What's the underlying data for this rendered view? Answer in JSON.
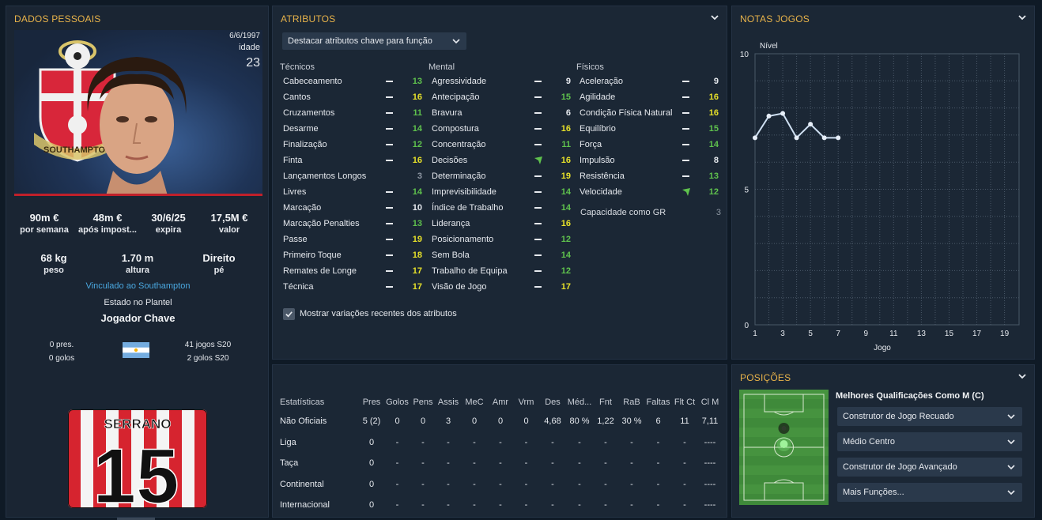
{
  "personal": {
    "title": "DADOS PESSOAIS",
    "dob": "6/6/1997",
    "age_label": "idade",
    "age": "23",
    "stats1": [
      {
        "value": "90m €",
        "label": "por semana"
      },
      {
        "value": "48m €",
        "label": "após impost..."
      },
      {
        "value": "30/6/25",
        "label": "expira"
      },
      {
        "value": "17,5M €",
        "label": "valor"
      }
    ],
    "stats2": [
      {
        "value": "68 kg",
        "label": "peso"
      },
      {
        "value": "1.70 m",
        "label": "altura"
      },
      {
        "value": "Direito",
        "label": "pé"
      }
    ],
    "contract_link": "Vinculado ao Southampton",
    "squad_label": "Estado no Plantel",
    "squad_value": "Jogador Chave",
    "intl_caps": "0 pres.",
    "intl_goals": "0 golos",
    "season_games": "41 jogos S20",
    "season_goals": "2 golos S20",
    "shirt_name": "SERRANO",
    "shirt_number": "15",
    "crest_text": "SOUTHAMPTON"
  },
  "attributes": {
    "title": "ATRIBUTOS",
    "highlight_dropdown": "Destacar atributos chave para função",
    "col_tecnicos": "Técnicos",
    "col_mental": "Mental",
    "col_fisicos": "Físicos",
    "tecnicos": [
      {
        "name": "Cabeceamento",
        "value": "13",
        "tier": "mid",
        "trend": "flat"
      },
      {
        "name": "Cantos",
        "value": "16",
        "tier": "high",
        "trend": "flat"
      },
      {
        "name": "Cruzamentos",
        "value": "11",
        "tier": "mid",
        "trend": "flat"
      },
      {
        "name": "Desarme",
        "value": "14",
        "tier": "mid",
        "trend": "flat"
      },
      {
        "name": "Finalização",
        "value": "12",
        "tier": "mid",
        "trend": "flat"
      },
      {
        "name": "Finta",
        "value": "16",
        "tier": "high",
        "trend": "flat"
      },
      {
        "name": "Lançamentos Longos",
        "value": "3",
        "tier": "low",
        "trend": "none"
      },
      {
        "name": "Livres",
        "value": "14",
        "tier": "mid",
        "trend": "flat"
      },
      {
        "name": "Marcação",
        "value": "10",
        "tier": "base",
        "trend": "flat"
      },
      {
        "name": "Marcação Penalties",
        "value": "13",
        "tier": "mid",
        "trend": "flat"
      },
      {
        "name": "Passe",
        "value": "19",
        "tier": "high",
        "trend": "flat"
      },
      {
        "name": "Primeiro Toque",
        "value": "18",
        "tier": "high",
        "trend": "flat"
      },
      {
        "name": "Remates de Longe",
        "value": "17",
        "tier": "high",
        "trend": "flat"
      },
      {
        "name": "Técnica",
        "value": "17",
        "tier": "high",
        "trend": "flat"
      }
    ],
    "mental": [
      {
        "name": "Agressividade",
        "value": "9",
        "tier": "base",
        "trend": "flat"
      },
      {
        "name": "Antecipação",
        "value": "15",
        "tier": "mid",
        "trend": "flat"
      },
      {
        "name": "Bravura",
        "value": "6",
        "tier": "base",
        "trend": "flat"
      },
      {
        "name": "Compostura",
        "value": "16",
        "tier": "high",
        "trend": "flat"
      },
      {
        "name": "Concentração",
        "value": "11",
        "tier": "mid",
        "trend": "flat"
      },
      {
        "name": "Decisões",
        "value": "16",
        "tier": "high",
        "trend": "up"
      },
      {
        "name": "Determinação",
        "value": "19",
        "tier": "high",
        "trend": "flat"
      },
      {
        "name": "Imprevisibilidade",
        "value": "14",
        "tier": "mid",
        "trend": "flat"
      },
      {
        "name": "Índice de Trabalho",
        "value": "14",
        "tier": "mid",
        "trend": "flat"
      },
      {
        "name": "Liderança",
        "value": "16",
        "tier": "high",
        "trend": "flat"
      },
      {
        "name": "Posicionamento",
        "value": "12",
        "tier": "mid",
        "trend": "flat"
      },
      {
        "name": "Sem Bola",
        "value": "14",
        "tier": "mid",
        "trend": "flat"
      },
      {
        "name": "Trabalho de Equipa",
        "value": "12",
        "tier": "mid",
        "trend": "flat"
      },
      {
        "name": "Visão de Jogo",
        "value": "17",
        "tier": "high",
        "trend": "flat"
      }
    ],
    "fisicos": [
      {
        "name": "Aceleração",
        "value": "9",
        "tier": "base",
        "trend": "flat"
      },
      {
        "name": "Agilidade",
        "value": "16",
        "tier": "high",
        "trend": "flat"
      },
      {
        "name": "Condição Física Natural",
        "value": "16",
        "tier": "high",
        "trend": "flat"
      },
      {
        "name": "Equilíbrio",
        "value": "15",
        "tier": "mid",
        "trend": "flat"
      },
      {
        "name": "Força",
        "value": "14",
        "tier": "mid",
        "trend": "flat"
      },
      {
        "name": "Impulsão",
        "value": "8",
        "tier": "base",
        "trend": "flat"
      },
      {
        "name": "Resistência",
        "value": "13",
        "tier": "mid",
        "trend": "flat"
      },
      {
        "name": "Velocidade",
        "value": "12",
        "tier": "mid",
        "trend": "up"
      }
    ],
    "gk_label": "Capacidade como GR",
    "gk_value": "3",
    "show_changes_label": "Mostrar variações recentes dos atributos",
    "colors": {
      "high": "#e6e02a",
      "mid": "#5fc24d",
      "base": "#e6e9ee",
      "low": "#8d96a2"
    }
  },
  "stats": {
    "headers": [
      "Estatísticas",
      "Pres",
      "Golos",
      "Pens",
      "Assis",
      "MeC",
      "Amr",
      "Vrm",
      "Des",
      "Méd...",
      "Fnt",
      "RaB",
      "Faltas",
      "Flt Ct",
      "Cl M"
    ],
    "rows": [
      [
        "Não Oficiais",
        "5 (2)",
        "0",
        "0",
        "3",
        "0",
        "0",
        "0",
        "4,68",
        "80 %",
        "1,22",
        "30 %",
        "6",
        "11",
        "7,11"
      ],
      [
        "Liga",
        "0",
        "-",
        "-",
        "-",
        "-",
        "-",
        "-",
        "-",
        "-",
        "-",
        "-",
        "-",
        "-",
        "----"
      ],
      [
        "Taça",
        "0",
        "-",
        "-",
        "-",
        "-",
        "-",
        "-",
        "-",
        "-",
        "-",
        "-",
        "-",
        "-",
        "----"
      ],
      [
        "Continental",
        "0",
        "-",
        "-",
        "-",
        "-",
        "-",
        "-",
        "-",
        "-",
        "-",
        "-",
        "-",
        "-",
        "----"
      ],
      [
        "Internacional",
        "0",
        "-",
        "-",
        "-",
        "-",
        "-",
        "-",
        "-",
        "-",
        "-",
        "-",
        "-",
        "-",
        "----"
      ]
    ]
  },
  "ratings": {
    "title": "NOTAS JOGOS",
    "chart_data": {
      "type": "line",
      "ylabel": "Nível",
      "xlabel": "Jogo",
      "ylim": [
        0,
        10
      ],
      "xlim": [
        1,
        20
      ],
      "yticks": [
        "10",
        "5",
        "0"
      ],
      "xticks": [
        "1",
        "3",
        "5",
        "7",
        "9",
        "11",
        "13",
        "15",
        "17",
        "19"
      ],
      "x": [
        1,
        2,
        3,
        4,
        5,
        6,
        7
      ],
      "y": [
        6.9,
        7.7,
        7.8,
        6.9,
        7.4,
        6.9,
        6.9
      ],
      "grid": true
    }
  },
  "positions": {
    "title": "POSIÇÕES",
    "best_title": "Melhores Qualificações Como M (C)",
    "roles": [
      "Construtor de Jogo Recuado",
      "Médio Centro",
      "Construtor de Jogo Avançado",
      "Mais Funções..."
    ]
  }
}
